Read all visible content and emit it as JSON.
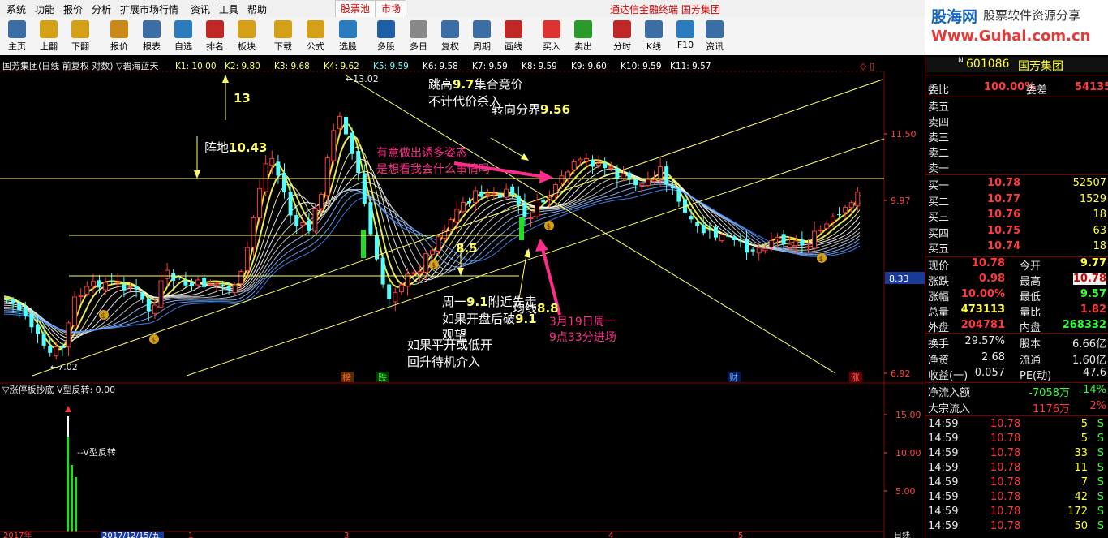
{
  "menubar": {
    "items": [
      "系统",
      "功能",
      "报价",
      "分析",
      "扩展市场行情",
      "资讯",
      "工具",
      "帮助"
    ],
    "tabs": [
      "股票池",
      "市场"
    ],
    "center_title": "通达信金融终端  国芳集团"
  },
  "toolbar": {
    "buttons": [
      "主页",
      "上翻",
      "下翻",
      "报价",
      "报表",
      "自选",
      "排名",
      "板块",
      "下载",
      "公式",
      "选股",
      "多股",
      "多日",
      "复权",
      "周期",
      "画线",
      "买入",
      "卖出",
      "分时",
      "K线",
      "F10",
      "资讯"
    ]
  },
  "logo": {
    "line1": "股海网",
    "line2": "股票软件资源分享",
    "line3": "Www.Guhai.com.cn"
  },
  "chart": {
    "header": "国芳集团(日线 前复权 对数) ▽碧海蓝天",
    "ma_labels": [
      "K1: 10.00",
      "K2: 9.80",
      "K3: 9.68",
      "K4: 9.62",
      "K5: 9.59",
      "K6: 9.58",
      "K7: 9.59",
      "K8: 9.59",
      "K9: 9.60",
      "K10: 9.59",
      "K11: 9.57"
    ],
    "price_axis": [
      "11.50",
      "9.97",
      "8.33",
      "6.92"
    ],
    "high_label": "13.02",
    "low_label": "7.02",
    "annotations": {
      "a13": "13",
      "zhendi_pre": "阵地",
      "zhendi_val": "10.43",
      "jump_pre": "跳高",
      "jump_val": "9.7",
      "jump_post": "集合竞价",
      "nocost": "不计代价杀入",
      "turn_pre": "转向分界",
      "turn_val": "9.56",
      "pink1": "有意做出诱多姿态",
      "pink2": "是想看我会什么事情吗",
      "v85": "8.5",
      "mon_pre": "周一",
      "mon_val": "9.1",
      "mon_post": "附近先走",
      "break_pre": "如果开盘后破",
      "break_val": "9.1",
      "watch": "观望",
      "line_pre": "均线",
      "line_val": "8.8",
      "ifflat": "如果平开或低开",
      "rebound": "回升待机介入",
      "date1": "3月19日周一",
      "date2": "9点33分进场"
    },
    "bottom_marks": [
      "榜",
      "跌",
      "财",
      "涨"
    ]
  },
  "indicator": {
    "header": "▽涨停板抄底 V型反转: 0.00",
    "label": "V型反转",
    "axis": [
      "15.00",
      "10.00",
      "5.00"
    ],
    "dates": [
      "2017年",
      "2017/12/15/五",
      "1",
      "3",
      "4",
      "5"
    ],
    "date_right": "日线"
  },
  "panel": {
    "code": "601086",
    "name": "国芳集团",
    "weibi_label": "委比",
    "weibi": "100.00%",
    "weicha_label": "委差",
    "weicha": "54135",
    "sells": [
      "卖五",
      "卖四",
      "卖三",
      "卖二",
      "卖一"
    ],
    "buys": [
      {
        "label": "买一",
        "price": "10.78",
        "vol": "52507"
      },
      {
        "label": "买二",
        "price": "10.77",
        "vol": "1529"
      },
      {
        "label": "买三",
        "price": "10.76",
        "vol": "18"
      },
      {
        "label": "买四",
        "price": "10.75",
        "vol": "63"
      },
      {
        "label": "买五",
        "price": "10.74",
        "vol": "18"
      }
    ],
    "quote": [
      [
        "现价",
        "10.78",
        "今开",
        "9.77"
      ],
      [
        "涨跌",
        "0.98",
        "最高",
        "10.78"
      ],
      [
        "涨幅",
        "10.00%",
        "最低",
        "9.57"
      ],
      [
        "总量",
        "473113",
        "量比",
        "1.82"
      ],
      [
        "外盘",
        "204781",
        "内盘",
        "268332"
      ]
    ],
    "fin": [
      [
        "换手",
        "29.57%",
        "股本",
        "6.66亿"
      ],
      [
        "净资",
        "2.68",
        "流通",
        "1.60亿"
      ],
      [
        "收益(一)",
        "0.057",
        "PE(动)",
        "47.6"
      ]
    ],
    "flow": [
      [
        "净流入额",
        "-7058万",
        "-14%"
      ],
      [
        "大宗流入",
        "1176万",
        "2%"
      ]
    ],
    "ticks": [
      [
        "14:59",
        "10.78",
        "5",
        "S"
      ],
      [
        "14:59",
        "10.78",
        "5",
        "S"
      ],
      [
        "14:59",
        "10.78",
        "33",
        "S"
      ],
      [
        "14:59",
        "10.78",
        "11",
        "S"
      ],
      [
        "14:59",
        "10.78",
        "7",
        "S"
      ],
      [
        "14:59",
        "10.78",
        "42",
        "S"
      ],
      [
        "14:59",
        "10.78",
        "172",
        "S"
      ],
      [
        "14:59",
        "10.78",
        "50",
        "S"
      ]
    ]
  },
  "colors": {
    "up": "#ff3b3b",
    "down": "#54ffff",
    "yellow": "#ffff33",
    "pink": "#ff2d8a",
    "green": "#22dd22",
    "grid": "#8b0000"
  }
}
